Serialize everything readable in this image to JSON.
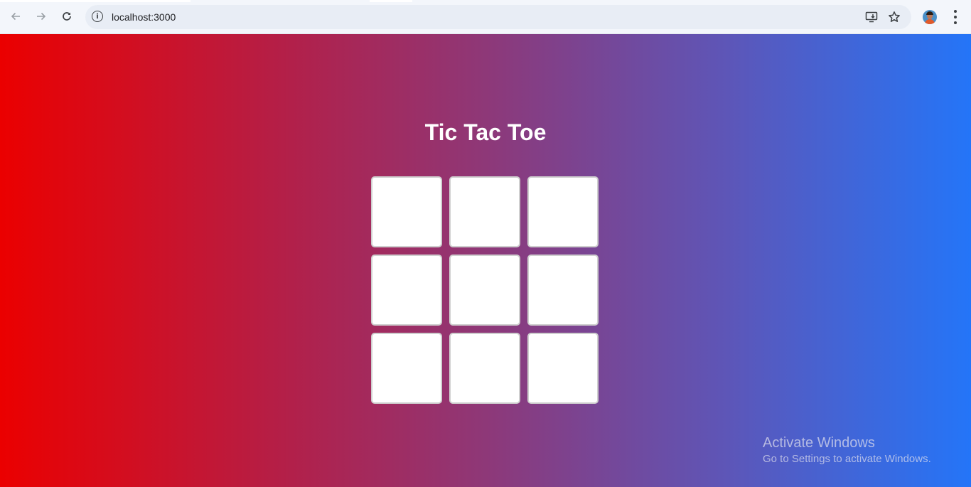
{
  "browser": {
    "url": "localhost:3000",
    "icons": {
      "back": "arrow-left-icon",
      "forward": "arrow-right-icon",
      "reload": "reload-icon",
      "site_info": "info-icon",
      "install": "install-app-icon",
      "bookmark": "star-icon",
      "menu": "more-vert-icon"
    }
  },
  "game": {
    "title": "Tic Tac Toe",
    "board": [
      "",
      "",
      "",
      "",
      "",
      "",
      "",
      "",
      ""
    ]
  },
  "watermark": {
    "title": "Activate Windows",
    "subtitle": "Go to Settings to activate Windows."
  },
  "colors": {
    "gradient_start": "#eb0000",
    "gradient_end": "#2475f8",
    "cell_background": "#ffffff",
    "title_text": "#ffffff"
  }
}
